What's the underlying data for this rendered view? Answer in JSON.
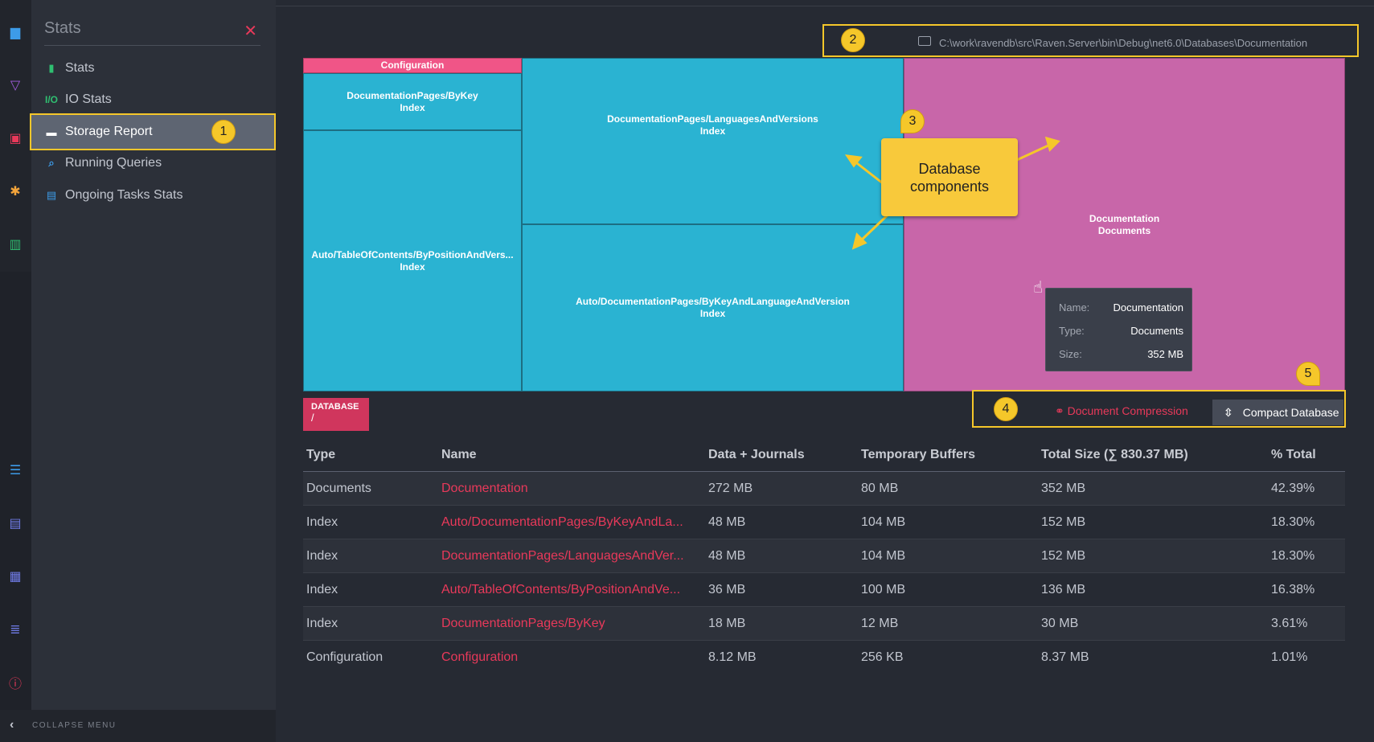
{
  "sidebar": {
    "title": "Stats",
    "items": [
      {
        "label": "Stats",
        "icon": "bar-chart-icon",
        "glyph": "▮",
        "color": "#2fbf71"
      },
      {
        "label": "IO Stats",
        "icon": "io-icon",
        "glyph": "I/O",
        "color": "#2fbf71"
      },
      {
        "label": "Storage Report",
        "icon": "storage-icon",
        "glyph": "▬",
        "color": "#ffffff"
      },
      {
        "label": "Running Queries",
        "icon": "search-icon",
        "glyph": "⌕",
        "color": "#3d9be8"
      },
      {
        "label": "Ongoing Tasks Stats",
        "icon": "tasks-icon",
        "glyph": "▤",
        "color": "#3d9be8"
      }
    ],
    "collapse_label": "COLLAPSE MENU"
  },
  "annotations": {
    "marker1": "1",
    "marker2": "2",
    "marker3": "3",
    "marker4": "4",
    "marker5": "5",
    "components_line1": "Database",
    "components_line2": "components"
  },
  "database": {
    "path": "C:\\work\\ravendb\\src\\Raven.Server\\bin\\Debug\\net6.0\\Databases\\Documentation",
    "chip_label": "DATABASE",
    "chip_path": "/"
  },
  "treemap": {
    "config_header": "Configuration",
    "cells": [
      {
        "name": "DocumentationPages/ByKey",
        "type": "Index"
      },
      {
        "name": "Auto/TableOfContents/ByPositionAndVers...",
        "type": "Index"
      },
      {
        "name": "DocumentationPages/LanguagesAndVersions",
        "type": "Index"
      },
      {
        "name": "Auto/DocumentationPages/ByKeyAndLanguageAndVersion",
        "type": "Index"
      },
      {
        "name": "Documentation",
        "type": "Documents"
      }
    ],
    "colors": {
      "index": "#2ab3d2",
      "documents": "#c866a9",
      "configuration": "#f05587"
    }
  },
  "tooltip": {
    "name_label": "Name:",
    "name_value": "Documentation",
    "type_label": "Type:",
    "type_value": "Documents",
    "size_label": "Size:",
    "size_value": "352 MB"
  },
  "actions": {
    "compression": "Document Compression",
    "compact": "Compact Database"
  },
  "table": {
    "headers": [
      "Type",
      "Name",
      "Data + Journals",
      "Temporary Buffers",
      "Total Size (∑ 830.37 MB)",
      "% Total"
    ],
    "rows": [
      [
        "Documents",
        "Documentation",
        "272 MB",
        "80 MB",
        "352 MB",
        "42.39%"
      ],
      [
        "Index",
        "Auto/DocumentationPages/ByKeyAndLa...",
        "48 MB",
        "104 MB",
        "152 MB",
        "18.30%"
      ],
      [
        "Index",
        "DocumentationPages/LanguagesAndVer...",
        "48 MB",
        "104 MB",
        "152 MB",
        "18.30%"
      ],
      [
        "Index",
        "Auto/TableOfContents/ByPositionAndVe...",
        "36 MB",
        "100 MB",
        "136 MB",
        "16.38%"
      ],
      [
        "Index",
        "DocumentationPages/ByKey",
        "18 MB",
        "12 MB",
        "30 MB",
        "3.61%"
      ],
      [
        "Configuration",
        "Configuration",
        "8.12 MB",
        "256 KB",
        "8.37 MB",
        "1.01%"
      ]
    ]
  }
}
